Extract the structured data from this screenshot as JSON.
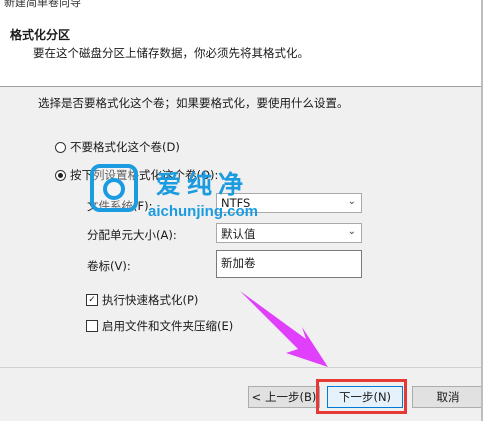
{
  "window": {
    "title": "新建简单卷向导"
  },
  "header": {
    "title": "格式化分区",
    "subtitle": "要在这个磁盘分区上储存数据，你必须先将其格式化。"
  },
  "content": {
    "instruction": "选择是否要格式化这个卷；如果要格式化，要使用什么设置。",
    "radio_no_format": "不要格式化这个卷(D)",
    "radio_format": "按下列设置格式化这个卷(O):",
    "radio_selected": "format",
    "file_system_label": "文件系统(F):",
    "file_system_value": "NTFS",
    "alloc_unit_label": "分配单元大小(A):",
    "alloc_unit_value": "默认值",
    "volume_label_label": "卷标(V):",
    "volume_label_value": "新加卷",
    "quick_format_label": "执行快速格式化(P)",
    "quick_format_checked": true,
    "compression_label": "启用文件和文件夹压缩(E)",
    "compression_checked": false
  },
  "watermark": {
    "cn": "爱纯净",
    "url": "aichunjing.com",
    "color": "#1b9be0"
  },
  "annotation": {
    "arrow_color": "#e040fb",
    "highlight_color": "#e53935"
  },
  "footer": {
    "back_label": "< 上一步(B)",
    "next_label": "下一步(N)",
    "cancel_label": "取消"
  }
}
